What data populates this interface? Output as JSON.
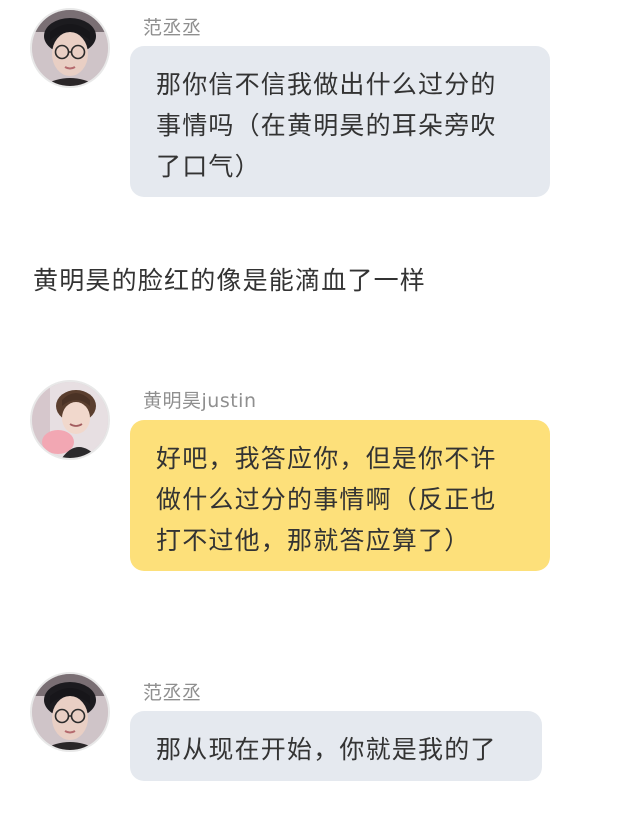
{
  "messages": [
    {
      "sender": "范丞丞",
      "lines": [
        "那你信不信我做出什么过分的",
        "事情吗（在黄明昊的耳朵旁吹",
        "了口气）"
      ],
      "bubble_color": "#e5e9ef"
    },
    {
      "sender": "黄明昊justin",
      "lines": [
        "好吧，我答应你，但是你不许",
        "做什么过分的事情啊（反正也",
        "打不过他，那就答应算了）"
      ],
      "bubble_color": "#fde07a"
    },
    {
      "sender": "范丞丞",
      "lines": [
        "那从现在开始，你就是我的了"
      ],
      "bubble_color": "#e5e9ef"
    }
  ],
  "narration": "黄明昊的脸红的像是能滴血了一样",
  "avatars": {
    "fan": "avatar-glasses-boy",
    "huang": "avatar-smiling-boy"
  }
}
